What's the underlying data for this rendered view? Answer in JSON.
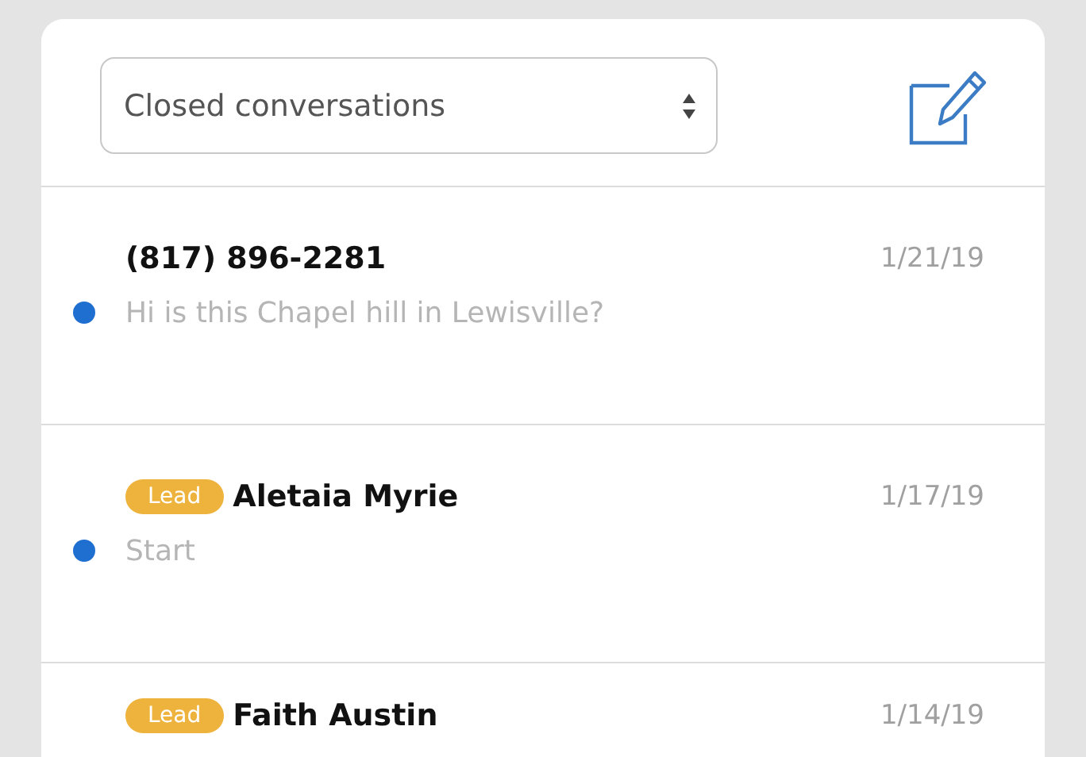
{
  "filter": {
    "value": "Closed conversations"
  },
  "conversations": [
    {
      "name": "(817) 896-2281",
      "date": "1/21/19",
      "preview": "Hi is this Chapel hill in Lewisville?",
      "unread": true
    },
    {
      "badge": "Lead",
      "name": "Aletaia Myrie",
      "date": "1/17/19",
      "preview": "Start",
      "unread": true
    },
    {
      "badge": "Lead",
      "name": "Faith Austin",
      "date": "1/14/19",
      "unread": false
    }
  ]
}
